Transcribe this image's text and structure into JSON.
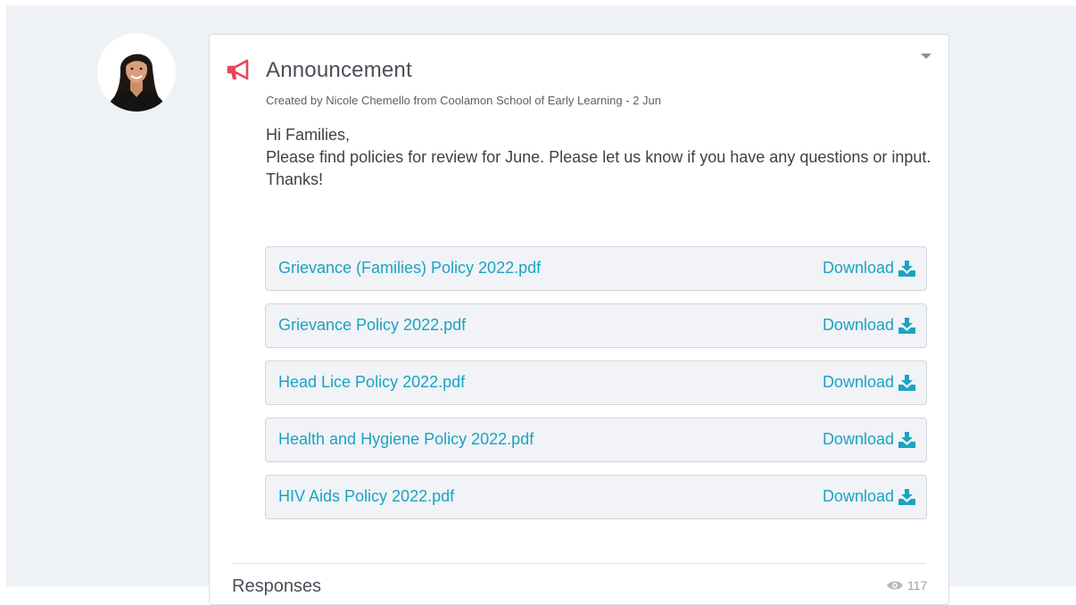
{
  "post": {
    "title": "Announcement",
    "meta": "Created by Nicole Chemello from Coolamon School of Early Learning - 2 Jun",
    "body": [
      "Hi Families,",
      "Please find policies for review for June. Please let us know if you have any questions or input.",
      "Thanks!"
    ],
    "attachments": [
      {
        "name": "Grievance (Families) Policy 2022.pdf",
        "action": "Download"
      },
      {
        "name": "Grievance Policy 2022.pdf",
        "action": "Download"
      },
      {
        "name": "Head Lice Policy 2022.pdf",
        "action": "Download"
      },
      {
        "name": "Health and Hygiene Policy 2022.pdf",
        "action": "Download"
      },
      {
        "name": "HIV Aids Policy 2022.pdf",
        "action": "Download"
      }
    ],
    "responses_label": "Responses",
    "views_count": "117"
  },
  "icons": {
    "post_type": "megaphone-icon",
    "menu": "caret-down-icon",
    "download": "download-icon",
    "views": "eye-icon"
  },
  "colors": {
    "accent": "#1aa3c2",
    "announcement": "#e8455a",
    "background": "#eef1f6"
  }
}
